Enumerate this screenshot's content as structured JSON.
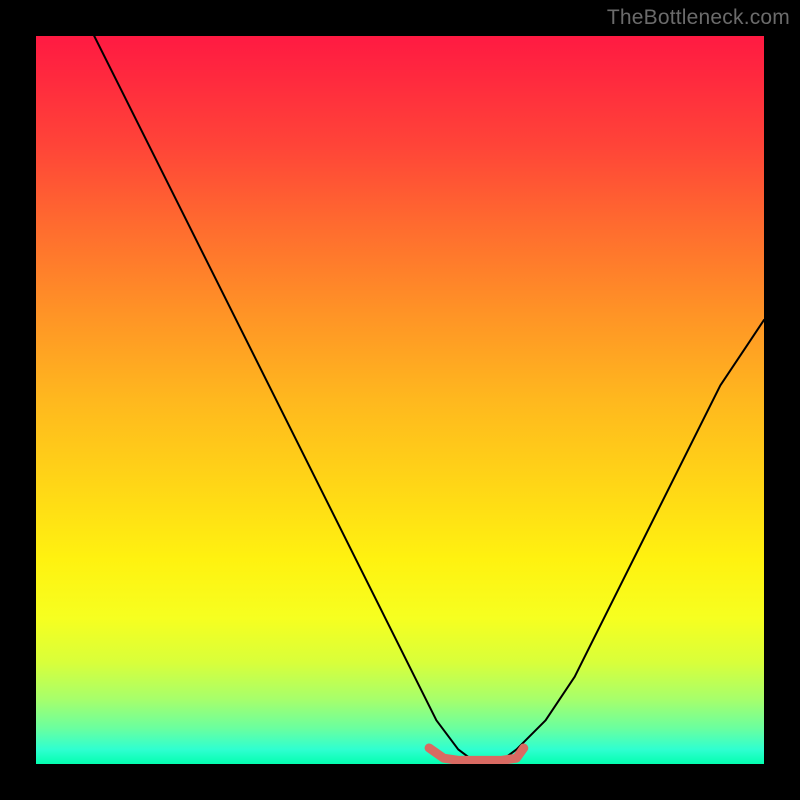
{
  "watermark": "TheBottleneck.com",
  "colors": {
    "curve_stroke": "#000000",
    "bottom_marker_stroke": "#d96a62",
    "frame_bg": "#000000"
  },
  "chart_data": {
    "type": "line",
    "title": "",
    "xlabel": "",
    "ylabel": "",
    "xlim": [
      0,
      100
    ],
    "ylim": [
      0,
      100
    ],
    "grid": false,
    "legend": false,
    "series": [
      {
        "name": "bottleneck-curve",
        "x": [
          8,
          12,
          16,
          20,
          24,
          28,
          32,
          36,
          40,
          44,
          48,
          52,
          55,
          58,
          60,
          62,
          64,
          66,
          70,
          74,
          78,
          82,
          86,
          90,
          94,
          98,
          100
        ],
        "y": [
          100,
          92,
          84,
          76,
          68,
          60,
          52,
          44,
          36,
          28,
          20,
          12,
          6,
          2,
          0.5,
          0.5,
          0.5,
          2,
          6,
          12,
          20,
          28,
          36,
          44,
          52,
          58,
          61
        ]
      },
      {
        "name": "bottom-marker",
        "x": [
          54,
          56,
          58,
          60,
          62,
          64,
          66,
          67
        ],
        "y": [
          2.2,
          0.8,
          0.5,
          0.5,
          0.5,
          0.5,
          0.8,
          2.2
        ]
      }
    ]
  }
}
